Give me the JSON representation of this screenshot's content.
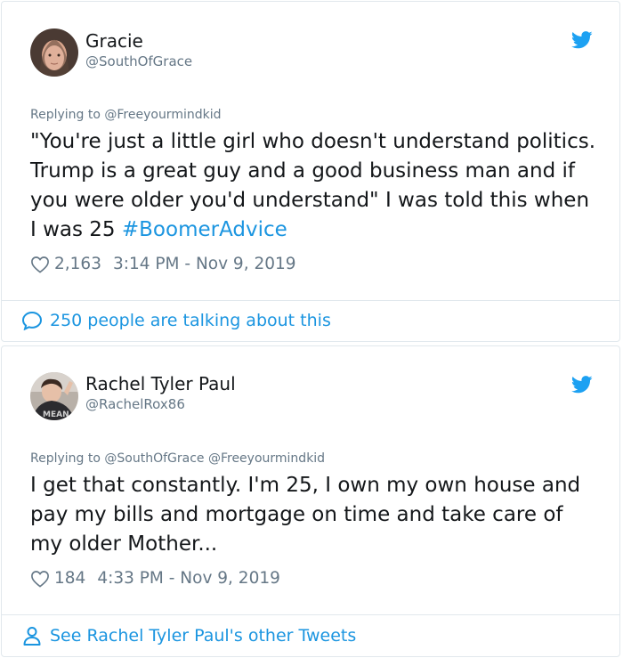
{
  "colors": {
    "accent": "#1b95e0",
    "secondary": "#657786",
    "text": "#14171a",
    "border": "#e1e8ed"
  },
  "tweets": [
    {
      "author_name": "Gracie",
      "author_handle": "@SouthOfGrace",
      "replying_to": "Replying to @Freeyourmindkid",
      "text": "\"You're just a little girl who doesn't understand politics. Trump is a great guy and a good business man and if you were older you'd understand\" I was told this when I was 25 ",
      "hashtag": "#BoomerAdvice",
      "likes": "2,163",
      "timestamp": "3:14 PM - Nov 9, 2019",
      "footer": "250 people are talking about this",
      "footer_icon": "speech-bubble-icon"
    },
    {
      "author_name": "Rachel Tyler Paul",
      "author_handle": "@RachelRox86",
      "replying_to": "Replying to @SouthOfGrace @Freeyourmindkid",
      "text": "I get that constantly. I'm 25, I own my own house and pay my bills and mortgage on time and take care of my older Mother...",
      "likes": "184",
      "timestamp": "4:33 PM - Nov 9, 2019",
      "footer": "See Rachel Tyler Paul's other Tweets",
      "footer_icon": "person-icon"
    }
  ]
}
